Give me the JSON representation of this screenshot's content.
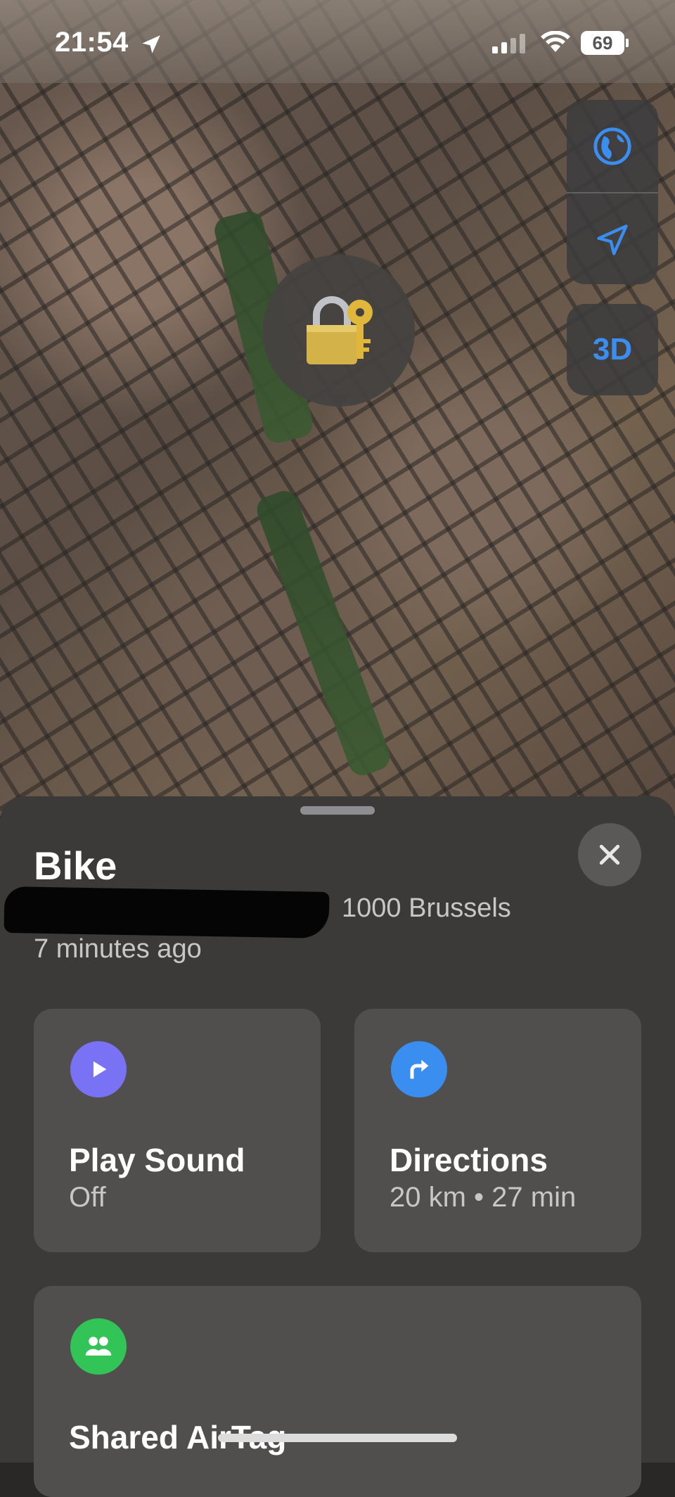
{
  "status_bar": {
    "time": "21:54",
    "battery": "69"
  },
  "map": {
    "controls": {
      "view_mode_icon": "globe-icon",
      "locate_icon": "location-arrow-icon",
      "toggle_3d": "3D"
    },
    "pin_icon": "lock-with-key-icon"
  },
  "sheet": {
    "title": "Bike",
    "address": "1000 Brussels",
    "updated": "7 minutes ago",
    "cards": [
      {
        "title": "Play Sound",
        "subtitle": "Off",
        "icon": "play-icon",
        "color": "#7a72f4"
      },
      {
        "title": "Directions",
        "subtitle": "20 km • 27 min",
        "icon": "turn-right-arrow-icon",
        "color": "#3a8ef0"
      },
      {
        "title": "Shared AirTag",
        "icon": "people-icon",
        "color": "#33c457"
      }
    ]
  },
  "colors": {
    "accent": "#3a8ef0",
    "sheet_bg": "#3b3a39",
    "card_bg": "#504f4e"
  }
}
